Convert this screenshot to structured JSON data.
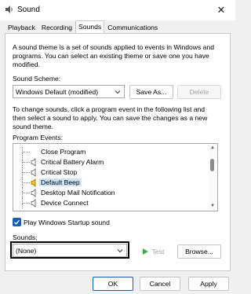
{
  "window": {
    "title": "Sound",
    "close_glyph": "✕",
    "icon": "speaker-app-icon"
  },
  "tabs": [
    {
      "label": "Playback",
      "active": false
    },
    {
      "label": "Recording",
      "active": false
    },
    {
      "label": "Sounds",
      "active": true
    },
    {
      "label": "Communications",
      "active": false
    }
  ],
  "description_lines": [
    "A sound theme is a set of sounds applied to events in Windows and",
    "programs. You can select an existing theme or save one you have",
    "modified."
  ],
  "scheme": {
    "label": "Sound Scheme:",
    "value": "Windows Default (modified)",
    "save_label": "Save As...",
    "delete_label": "Delete"
  },
  "instructions_lines": [
    "To change sounds, click a program event in the following list and",
    "then select a sound to apply. You can save the changes as a new",
    "sound theme."
  ],
  "events": {
    "label": "Program Events:",
    "items": [
      {
        "label": "Close Program",
        "selected": false
      },
      {
        "label": "Critical Battery Alarm",
        "selected": false
      },
      {
        "label": "Critical Stop",
        "selected": false
      },
      {
        "label": "Default Beep",
        "selected": true
      },
      {
        "label": "Desktop Mail Notification",
        "selected": false
      },
      {
        "label": "Device Connect",
        "selected": false
      }
    ]
  },
  "startup": {
    "label": "Play Windows Startup sound",
    "checked": true
  },
  "sounds": {
    "label": "Sounds:",
    "value": "(None)",
    "test_label": "Test",
    "browse_label": "Browse..."
  },
  "footer": {
    "ok_label": "OK",
    "cancel_label": "Cancel",
    "apply_label": "Apply"
  },
  "colors": {
    "accent": "#1a5fb4",
    "selection": "#cce4f7",
    "test_icon": "#3cb043"
  }
}
